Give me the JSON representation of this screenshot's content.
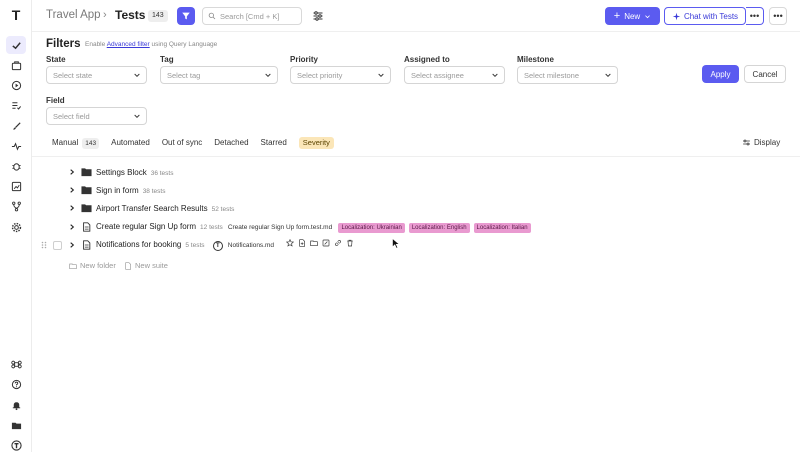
{
  "header": {
    "app_name": "Travel App",
    "separator": "›",
    "page_title": "Tests",
    "count": "143",
    "search_placeholder": "Search [Cmd + K]",
    "new_label": "New",
    "chat_label": "Chat with Tests",
    "chat_more": "•••",
    "more": "•••"
  },
  "filters": {
    "title": "Filters",
    "hint_prefix": "Enable",
    "hint_link": "Advanced filter",
    "hint_suffix": "using Query Language",
    "fields": [
      {
        "label": "State",
        "placeholder": "Select state"
      },
      {
        "label": "Tag",
        "placeholder": "Select tag"
      },
      {
        "label": "Priority",
        "placeholder": "Select priority"
      },
      {
        "label": "Assigned to",
        "placeholder": "Select assignee"
      },
      {
        "label": "Milestone",
        "placeholder": "Select milestone"
      },
      {
        "label": "Field",
        "placeholder": "Select field"
      }
    ],
    "apply_label": "Apply",
    "cancel_label": "Cancel"
  },
  "tabs": {
    "items": [
      {
        "label": "Manual",
        "count": "143"
      },
      {
        "label": "Automated"
      },
      {
        "label": "Out of sync"
      },
      {
        "label": "Detached"
      },
      {
        "label": "Starred"
      },
      {
        "label": "Severity"
      }
    ],
    "display_label": "Display"
  },
  "tree": {
    "rows": [
      {
        "name": "Settings Block",
        "count": "36 tests",
        "type": "folder"
      },
      {
        "name": "Sign in form",
        "count": "38 tests",
        "type": "folder"
      },
      {
        "name": "Airport Transfer Search Results",
        "count": "52 tests",
        "type": "folder"
      },
      {
        "name": "Create regular Sign Up form",
        "count": "12 tests",
        "type": "suite",
        "file": "Create regular Sign Up form.test.md",
        "tags": [
          "Localization: Ukrainian",
          "Localization: English",
          "Localization: Italian"
        ]
      },
      {
        "name": "Notifications for booking",
        "count": "5 tests",
        "type": "suite",
        "file": "Notifications.md"
      }
    ],
    "new_folder": "New folder",
    "new_suite": "New suite"
  },
  "colors": {
    "accent": "#5b5bf0",
    "tag": "#e99ad0",
    "severity": "#fbe6b8"
  }
}
